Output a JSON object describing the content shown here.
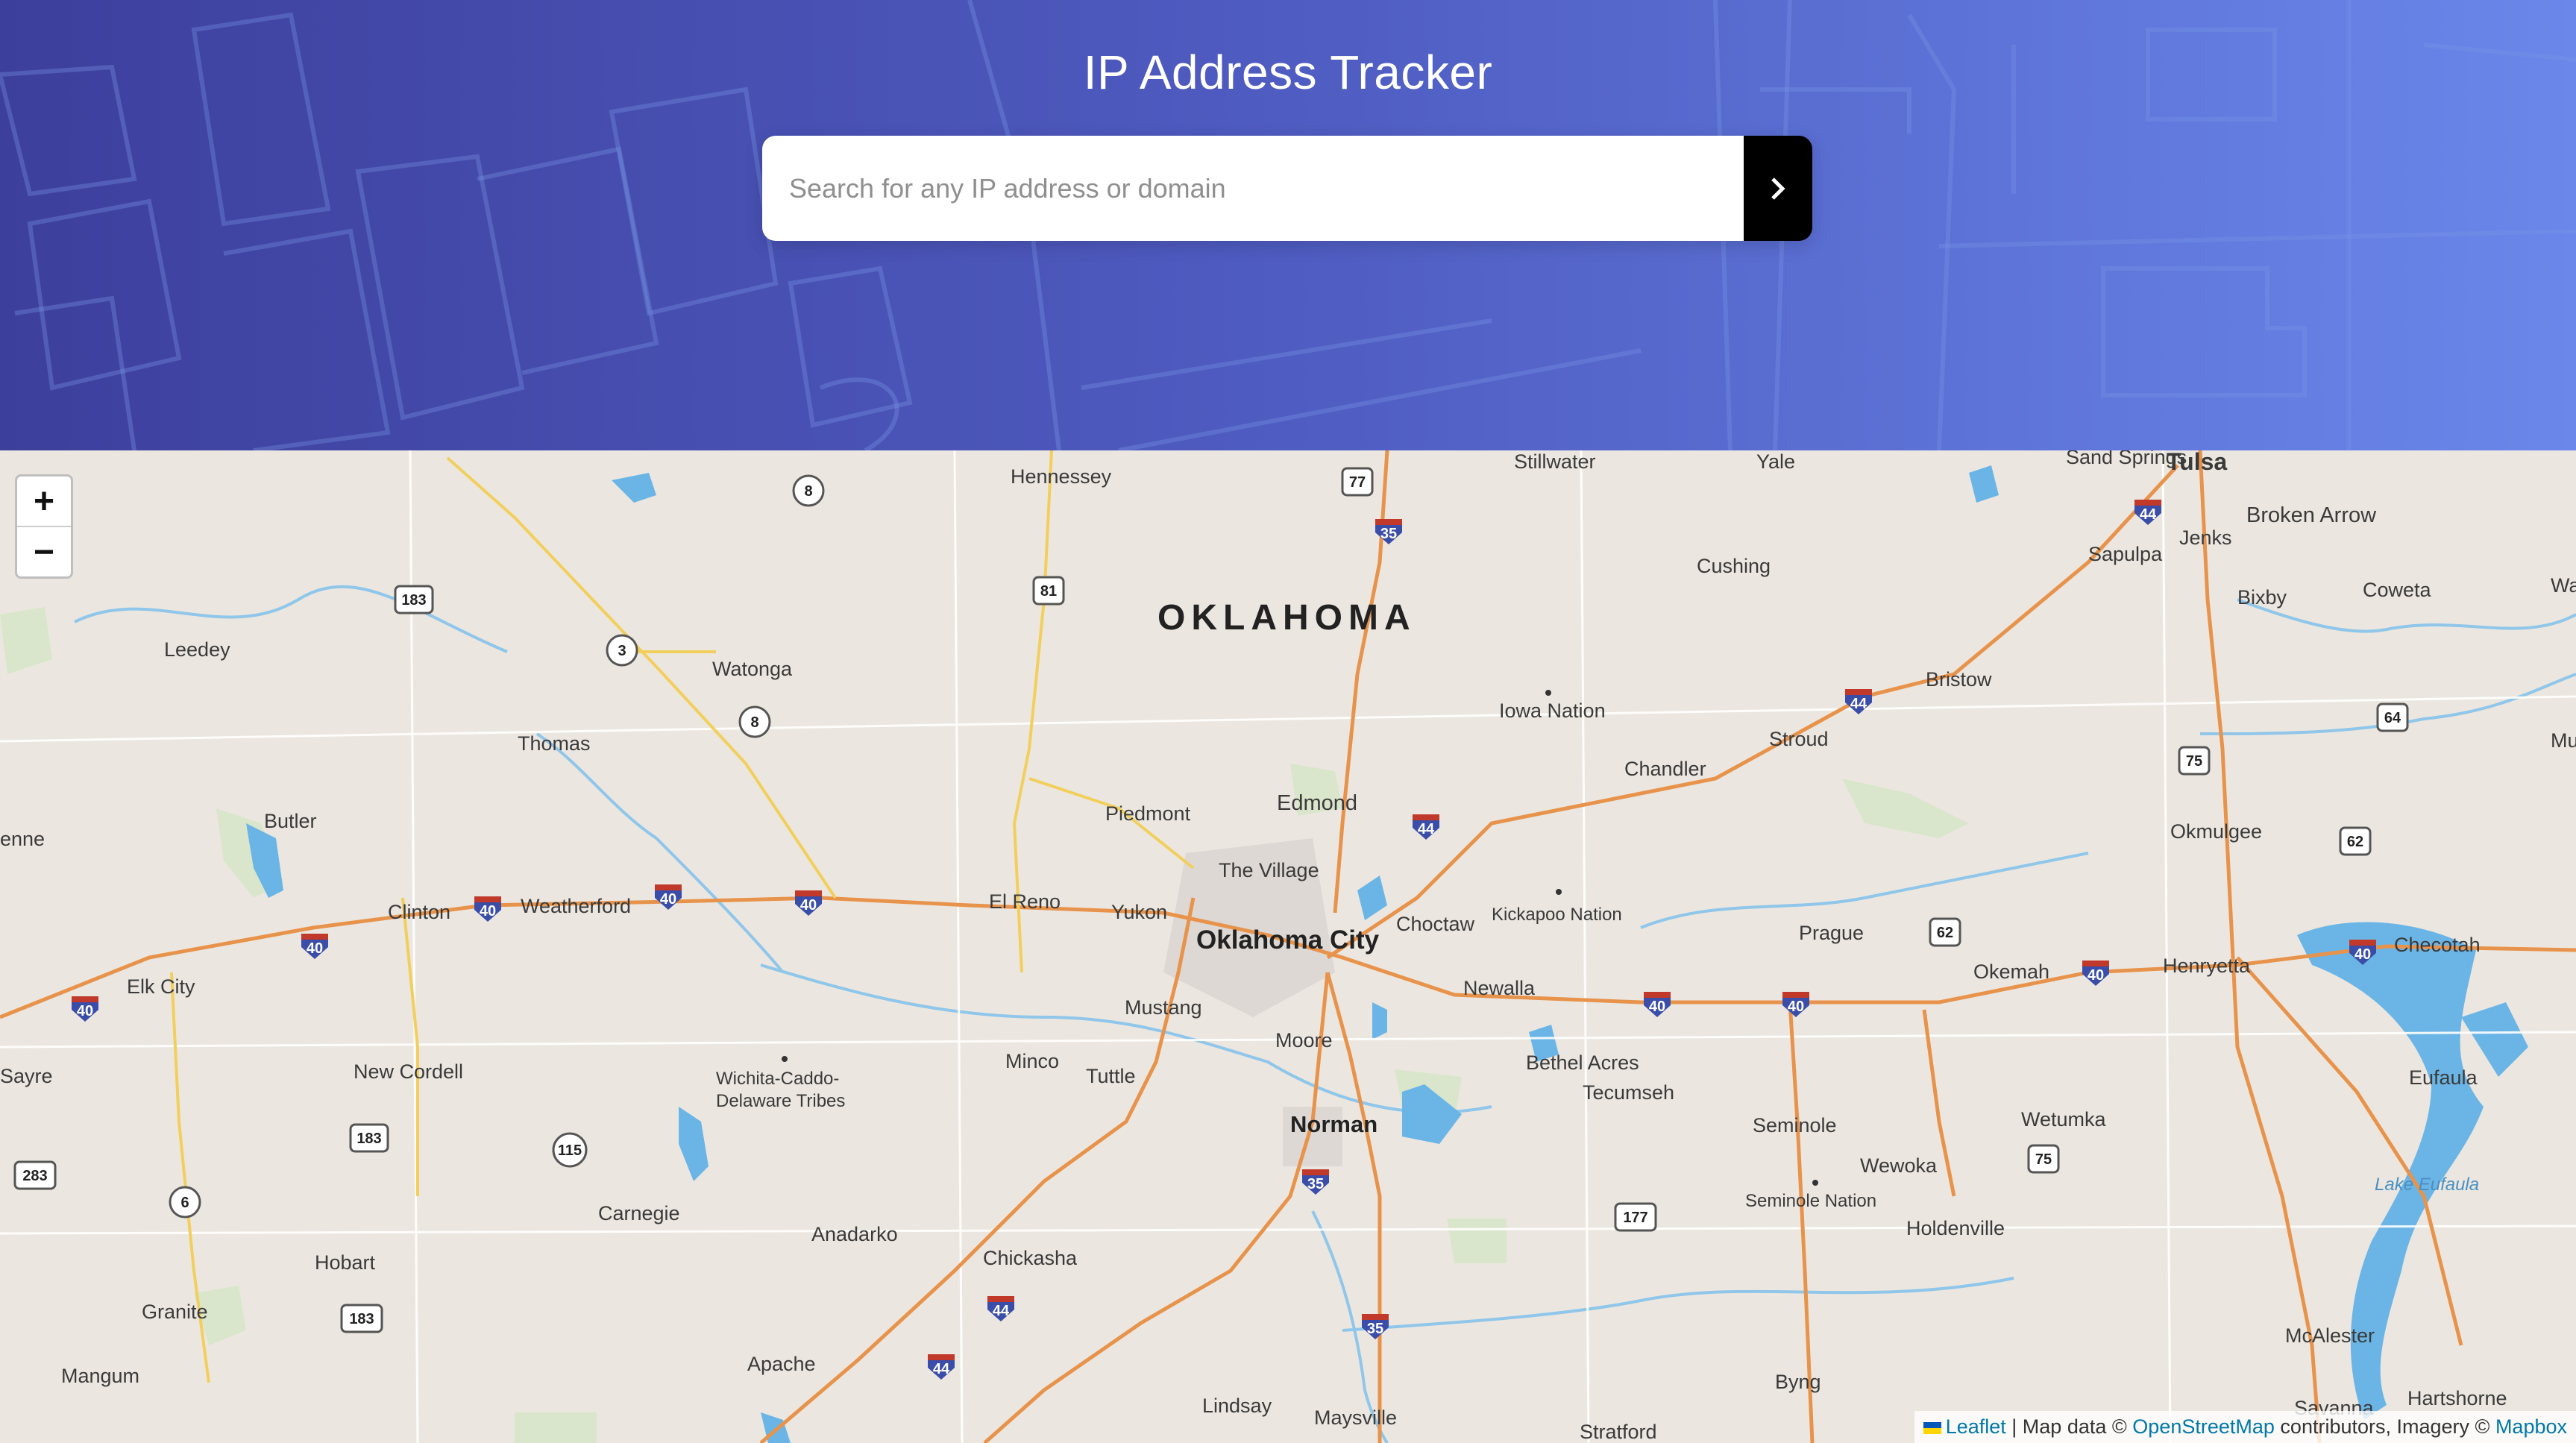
{
  "header": {
    "title": "IP Address Tracker",
    "search_placeholder": "Search for any IP address or domain",
    "submit_icon": "chevron-right-icon"
  },
  "map": {
    "zoom_in_label": "+",
    "zoom_out_label": "−",
    "state_label": "OKLAHOMA",
    "places": [
      "Hennessey",
      "Stillwater",
      "Yale",
      "Sand Springs",
      "Tulsa",
      "Broken Arrow",
      "Jenks",
      "Sapulpa",
      "Coweta",
      "Bixby",
      "Wago",
      "Leedey",
      "Watonga",
      "Cushing",
      "Iowa Nation",
      "Thomas",
      "Bristow",
      "Stroud",
      "Muske",
      "Chandler",
      "Butler",
      "Edmond",
      "Piedmont",
      "Okmulgee",
      "enne",
      "The Village",
      "Clinton",
      "Weatherford",
      "El Reno",
      "Yukon",
      "Oklahoma City",
      "Choctaw",
      "Kickapoo Nation",
      "Prague",
      "Okemah",
      "Henryetta",
      "Checotah",
      "Elk City",
      "Mustang",
      "Newalla",
      "Moore",
      "Minco",
      "Tuttle",
      "Wichita-Caddo-",
      "Delaware Tribes",
      "Sayre",
      "New Cordell",
      "Bethel Acres",
      "Tecumseh",
      "Eufaula",
      "Norman",
      "Seminole",
      "Wetumka",
      "Wewoka",
      "Lake Eufaula",
      "Carnegie",
      "Seminole Nation",
      "Anadarko",
      "Holdenville",
      "Chickasha",
      "Hobart",
      "Granite",
      "Mangum",
      "Apache",
      "McAlester",
      "Byng",
      "Lindsay",
      "Maysville",
      "Hartshorne",
      "Stratford",
      "Savanna"
    ],
    "highway_shields": [
      "8",
      "77",
      "35",
      "183",
      "81",
      "3",
      "8",
      "44",
      "64",
      "75",
      "62",
      "40",
      "40",
      "40",
      "40",
      "40",
      "40",
      "62",
      "40",
      "40",
      "40",
      "44",
      "44",
      "35",
      "115",
      "183",
      "283",
      "6",
      "177",
      "75",
      "183",
      "44",
      "35",
      "44"
    ],
    "attribution": {
      "leaflet": "Leaflet",
      "map_data_prefix": "| Map data ©",
      "osm": "OpenStreetMap",
      "imagery": "contributors, Imagery ©",
      "mapbox": "Mapbox"
    }
  },
  "colors": {
    "header_gradient_start": "#3d3f9c",
    "header_gradient_end": "#6a87ea",
    "search_button": "#000000",
    "map_background": "#ebe7e0",
    "interstate": "#3a4da8",
    "major_road": "#e8934b",
    "water": "#6bb5e6"
  }
}
